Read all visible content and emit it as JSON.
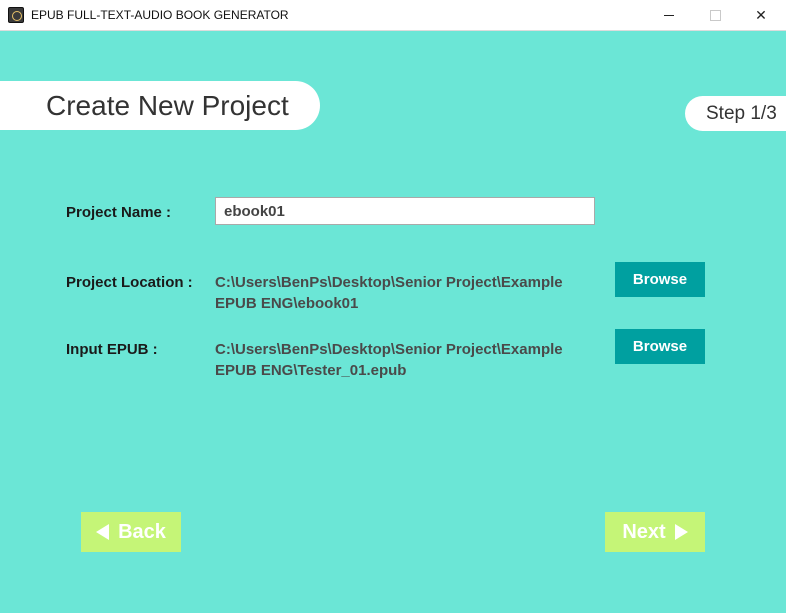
{
  "window": {
    "title": "EPUB FULL-TEXT-AUDIO BOOK GENERATOR",
    "icon": "app-logo-icon"
  },
  "header": {
    "title": "Create New Project",
    "step": "Step 1/3"
  },
  "form": {
    "project_name_label": "Project Name :",
    "project_name_value": "ebook01",
    "project_location_label": "Project Location :",
    "project_location_path": "C:\\Users\\BenPs\\Desktop\\Senior Project\\Example EPUB ENG\\ebook01",
    "input_epub_label": "Input EPUB :",
    "input_epub_path": "C:\\Users\\BenPs\\Desktop\\Senior Project\\Example EPUB ENG\\Tester_01.epub",
    "browse_label": "Browse"
  },
  "nav": {
    "back_label": "Back",
    "next_label": "Next"
  },
  "colors": {
    "background": "#6be6d6",
    "browse_button": "#00a0a0",
    "nav_button": "#c5f577"
  }
}
